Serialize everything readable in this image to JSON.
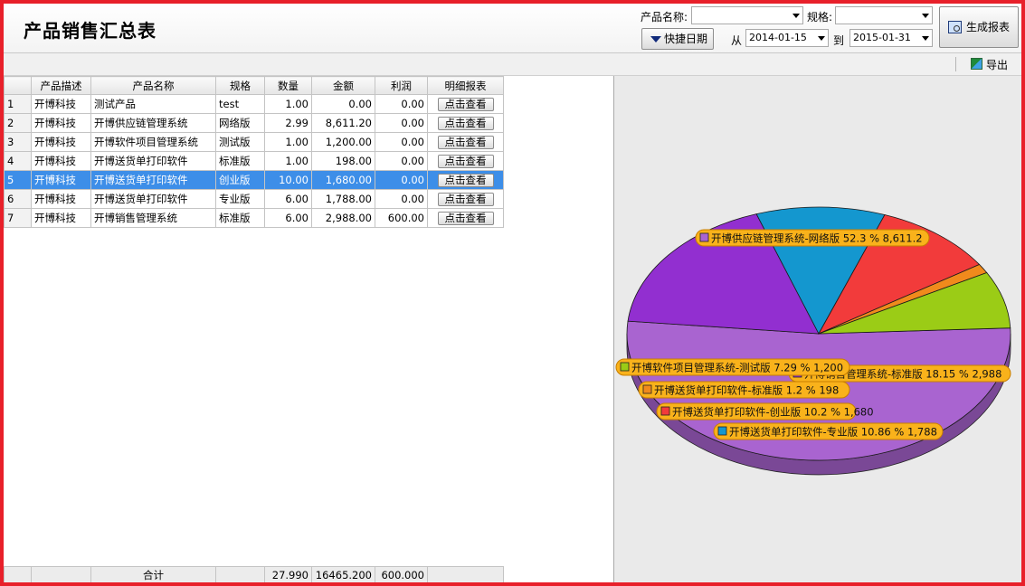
{
  "header": {
    "title": "产品销售汇总表",
    "product_name_label": "产品名称:",
    "product_name_value": "",
    "spec_label": "规格:",
    "spec_value": "",
    "quick_date_label": "快捷日期",
    "from_label": "从",
    "from_date": "2014-01-15",
    "to_label": "到",
    "to_date": "2015-01-31",
    "generate_label": "生成报表"
  },
  "toolbar": {
    "export_label": "导出"
  },
  "table": {
    "columns": [
      "产品描述",
      "产品名称",
      "规格",
      "数量",
      "金额",
      "利润",
      "明细报表"
    ],
    "rows": [
      {
        "idx": "1",
        "desc": "开博科技",
        "name": "测试产品",
        "spec": "test",
        "qty": "1.00",
        "amount": "0.00",
        "profit": "0.00",
        "action": "点击查看"
      },
      {
        "idx": "2",
        "desc": "开博科技",
        "name": "开博供应链管理系统",
        "spec": "网络版",
        "qty": "2.99",
        "amount": "8,611.20",
        "profit": "0.00",
        "action": "点击查看"
      },
      {
        "idx": "3",
        "desc": "开博科技",
        "name": "开博软件项目管理系统",
        "spec": "测试版",
        "qty": "1.00",
        "amount": "1,200.00",
        "profit": "0.00",
        "action": "点击查看"
      },
      {
        "idx": "4",
        "desc": "开博科技",
        "name": "开博送货单打印软件",
        "spec": "标准版",
        "qty": "1.00",
        "amount": "198.00",
        "profit": "0.00",
        "action": "点击查看"
      },
      {
        "idx": "5",
        "desc": "开博科技",
        "name": "开博送货单打印软件",
        "spec": "创业版",
        "qty": "10.00",
        "amount": "1,680.00",
        "profit": "0.00",
        "action": "点击查看",
        "selected": true
      },
      {
        "idx": "6",
        "desc": "开博科技",
        "name": "开博送货单打印软件",
        "spec": "专业版",
        "qty": "6.00",
        "amount": "1,788.00",
        "profit": "0.00",
        "action": "点击查看"
      },
      {
        "idx": "7",
        "desc": "开博科技",
        "name": "开博销售管理系统",
        "spec": "标准版",
        "qty": "6.00",
        "amount": "2,988.00",
        "profit": "600.00",
        "action": "点击查看"
      }
    ],
    "footer": {
      "label": "合计",
      "qty": "27.990",
      "amount": "16465.200",
      "profit": "600.000"
    }
  },
  "chart_data": {
    "type": "pie",
    "slices": [
      {
        "label": "开博供应链管理系统-网络版 52.3 % 8,611.2",
        "value": 8611.2,
        "percent": 52.3,
        "color": "#a964d0"
      },
      {
        "label": "开博销售管理系统-标准版 18.15 % 2,988",
        "value": 2988,
        "percent": 18.15,
        "color": "#922fd0"
      },
      {
        "label": "开博送货单打印软件-专业版 10.86 % 1,788",
        "value": 1788,
        "percent": 10.86,
        "color": "#1497cf"
      },
      {
        "label": "开博送货单打印软件-创业版 10.2 % 1,680",
        "value": 1680,
        "percent": 10.2,
        "color": "#f23b3b"
      },
      {
        "label": "开博送货单打印软件-标准版 1.2 % 198",
        "value": 198,
        "percent": 1.2,
        "color": "#f08a1c"
      },
      {
        "label": "开博软件项目管理系统-测试版 7.29 % 1,200",
        "value": 1200,
        "percent": 7.29,
        "color": "#9bcc16"
      }
    ],
    "colors": {
      "label_fill": "#f9b21b",
      "label_border": "#c87e00"
    }
  }
}
